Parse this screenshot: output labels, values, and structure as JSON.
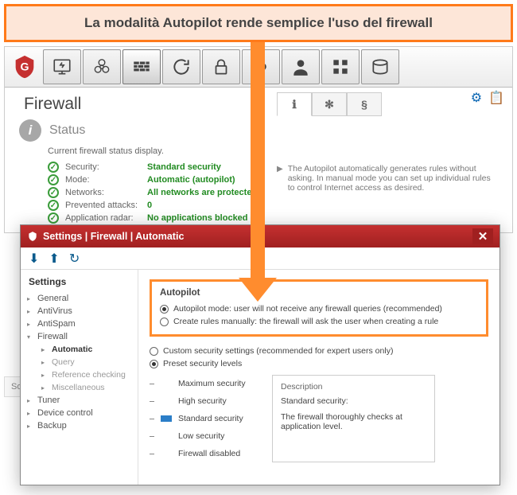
{
  "annotation": "La modalità Autopilot rende semplice l'uso del firewall",
  "page_title": "Firewall",
  "status_label": "Status",
  "status_desc": "Current firewall status display.",
  "stats": {
    "security_label": "Security:",
    "security_value": "Standard security",
    "mode_label": "Mode:",
    "mode_value": "Automatic (autopilot)",
    "networks_label": "Networks:",
    "networks_value": "All networks are protected",
    "attacks_label": "Prevented attacks:",
    "attacks_value": "0",
    "radar_label": "Application radar:",
    "radar_value": "No applications blocked"
  },
  "autopilot_note": "The Autopilot automatically generates rules without asking. In manual mode you can set up individual rules to control Internet access as desired.",
  "dialog": {
    "title": "Settings | Firewall | Automatic",
    "side_heading": "Settings",
    "tree": {
      "general": "General",
      "antivirus": "AntiVirus",
      "antispam": "AntiSpam",
      "firewall": "Firewall",
      "automatic": "Automatic",
      "query": "Query",
      "refcheck": "Reference checking",
      "misc": "Miscellaneous",
      "tuner": "Tuner",
      "device": "Device control",
      "backup": "Backup"
    },
    "autopilot_heading": "Autopilot",
    "opt_autopilot": "Autopilot mode: user will not receive any firewall queries (recommended)",
    "opt_manual": "Create rules manually: the firewall will ask the user when creating a rule",
    "opt_custom": "Custom security settings (recommended for expert users only)",
    "opt_preset": "Preset security levels",
    "levels": {
      "max": "Maximum security",
      "high": "High security",
      "standard": "Standard security",
      "low": "Low security",
      "disabled": "Firewall disabled"
    },
    "desc_heading": "Description",
    "desc_title": "Standard security:",
    "desc_body": "The firewall thoroughly checks at application level."
  },
  "software_label": "Softwa"
}
